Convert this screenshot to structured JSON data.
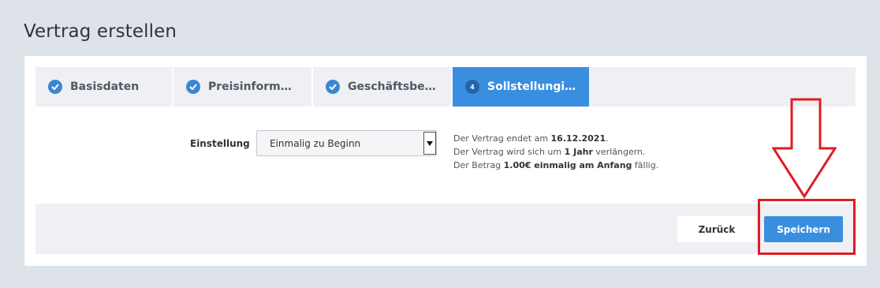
{
  "page": {
    "title": "Vertrag erstellen"
  },
  "tabs": [
    {
      "label": "Basisdaten",
      "state": "done"
    },
    {
      "label": "Preisinform…",
      "state": "done"
    },
    {
      "label": "Geschäftsbe…",
      "state": "done"
    },
    {
      "label": "Sollstellungi…",
      "state": "active",
      "number": "4"
    }
  ],
  "form": {
    "label": "Einstellung",
    "select_value": "Einmalig zu Beginn"
  },
  "info": {
    "line1_pre": "Der Vertrag endet am ",
    "line1_bold": "16.12.2021",
    "line1_post": ".",
    "line2_pre": "Der Vertrag wird sich um ",
    "line2_bold": "1 Jahr",
    "line2_post": " verlängern.",
    "line3_pre": "Der Betrag ",
    "line3_bold": "1.00€ einmalig am Anfang",
    "line3_post": " fällig."
  },
  "footer": {
    "back_label": "Zurück",
    "save_label": "Speichern"
  },
  "colors": {
    "accent": "#3a8ee0",
    "annotation": "#e01b24",
    "background": "#dee2e9"
  }
}
